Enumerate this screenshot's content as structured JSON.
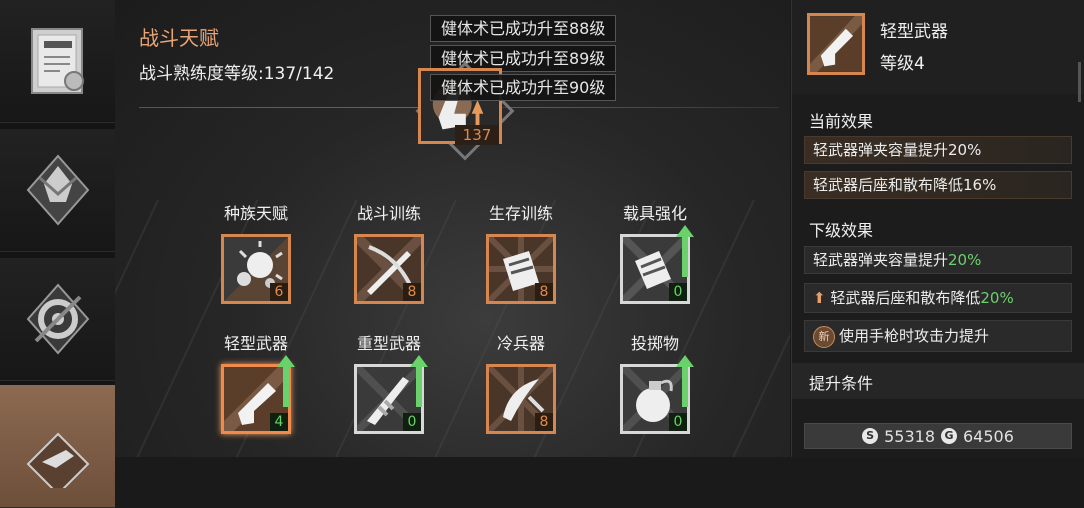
{
  "sidebar": {
    "tabs": [
      {
        "icon": "trade-certificate-icon"
      },
      {
        "icon": "talent-emblem-icon"
      },
      {
        "icon": "gear-emblem-icon"
      },
      {
        "icon": "weapon-tab-icon",
        "active": true
      }
    ]
  },
  "main": {
    "title": "战斗天赋",
    "mastery_label": "战斗熟练度等级:137/142",
    "notifications": [
      "健体术已成功升至88级",
      "健体术已成功升至89级",
      "健体术已成功升至90级"
    ],
    "rank_value": "137",
    "skills": [
      {
        "label": "种族天赋",
        "level": "6",
        "style": "orange",
        "icon": "virus-cells-icon"
      },
      {
        "label": "战斗训练",
        "level": "8",
        "style": "orange",
        "icon": "crossed-blades-icon"
      },
      {
        "label": "生存训练",
        "level": "8",
        "style": "orange",
        "icon": "survival-pack-icon"
      },
      {
        "label": "载具强化",
        "level": "0",
        "style": "gray",
        "upgradable": true,
        "icon": "vehicle-pack-icon"
      },
      {
        "label": "轻型武器",
        "level": "4",
        "style": "orange",
        "upgradable": true,
        "selected": true,
        "icon": "pistol-icon"
      },
      {
        "label": "重型武器",
        "level": "0",
        "style": "gray",
        "upgradable": true,
        "icon": "rocket-launcher-icon"
      },
      {
        "label": "冷兵器",
        "level": "8",
        "style": "orange",
        "icon": "melee-blades-icon"
      },
      {
        "label": "投掷物",
        "level": "0",
        "style": "gray",
        "upgradable": true,
        "icon": "grenade-icon"
      }
    ]
  },
  "detail": {
    "name": "轻型武器",
    "level_label": "等级4",
    "current_effect_title": "当前效果",
    "current_effects": [
      "轻武器弹夹容量提升20%",
      "轻武器后座和散布降低16%"
    ],
    "next_effect_title": "下级效果",
    "next_effects": [
      {
        "prefix": "轻武器弹夹容量提升",
        "value": "20%",
        "marker": "none"
      },
      {
        "prefix": "轻武器后座和散布降低",
        "value": "20%",
        "marker": "up-arrow"
      },
      {
        "prefix": "使用手枪时攻击力提升",
        "value": "",
        "marker": "new",
        "badge": "新"
      }
    ],
    "requirement_title": "提升条件",
    "cost": {
      "silver_symbol": "S",
      "silver": "55318",
      "gold_symbol": "G",
      "gold": "64506"
    }
  },
  "colors": {
    "accent": "#d6874f",
    "title": "#e9a476",
    "green": "#6ad26b"
  }
}
